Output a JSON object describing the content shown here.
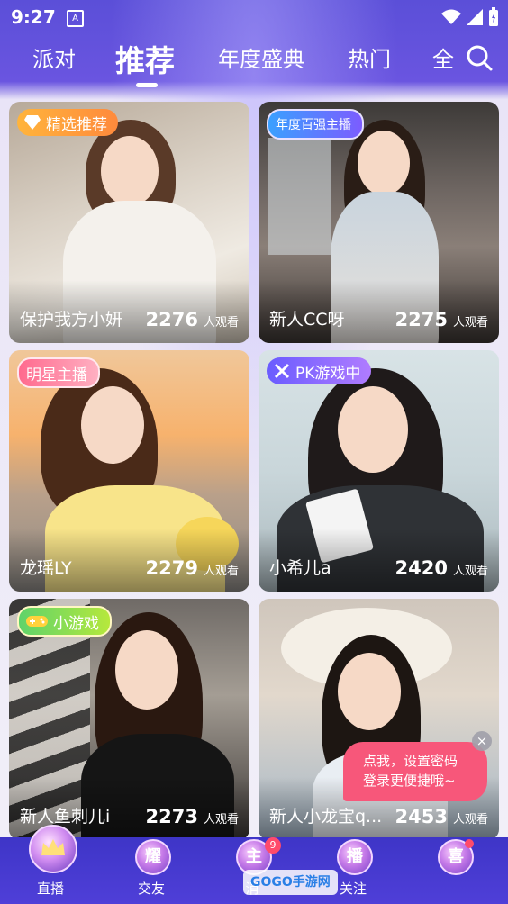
{
  "status_bar": {
    "time": "9:27",
    "notification_letter": "A"
  },
  "tabs": [
    {
      "label": "派对"
    },
    {
      "label": "推荐",
      "active": true
    },
    {
      "label": "年度盛典"
    },
    {
      "label": "热门"
    },
    {
      "label": "全"
    }
  ],
  "viewers_label": "人观看",
  "cards": [
    {
      "name": "保护我方小妍",
      "count": "2276",
      "badge": "精选推荐",
      "badge_icon": "diamond-icon"
    },
    {
      "name": "新人CC呀",
      "count": "2275",
      "badge": "年度百强主播",
      "badge_icon": ""
    },
    {
      "name": "龙瑶LY",
      "count": "2279",
      "badge": "明星主播",
      "badge_icon": ""
    },
    {
      "name": "小希儿a",
      "count": "2420",
      "badge": "PK游戏中",
      "badge_icon": "crossed-swords-icon"
    },
    {
      "name": "新人鱼刺儿i",
      "count": "2273",
      "badge": "小游戏",
      "badge_icon": "gamepad-icon"
    },
    {
      "name": "新人小龙宝q...",
      "count": "2453",
      "badge": "",
      "badge_icon": ""
    }
  ],
  "tooltip": {
    "line1": "点我，设置密码",
    "line2": "登录更便捷哦~",
    "close": "×"
  },
  "bottom_nav": [
    {
      "label": "直播",
      "icon_char": "",
      "active": true
    },
    {
      "label": "交友",
      "icon_char": "耀"
    },
    {
      "label": "消",
      "icon_char": "主",
      "badge": "9"
    },
    {
      "label": "关注",
      "icon_char": "播"
    },
    {
      "label": "",
      "icon_char": "喜"
    }
  ],
  "watermark": "GOGO手游网",
  "colors": {
    "accent_pink": "#f7577a",
    "nav_bg": "#3e35c7",
    "badge_orange": "#ff9a3c"
  }
}
